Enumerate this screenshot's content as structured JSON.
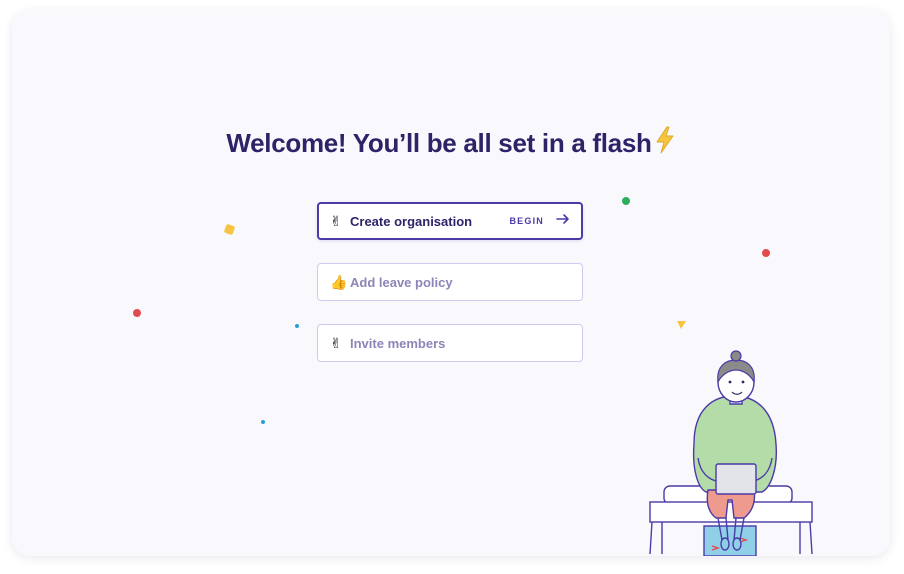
{
  "welcome": {
    "title": "Welcome! You’ll be all set in a flash",
    "title_icon": "lightning-bolt-icon"
  },
  "steps": [
    {
      "emoji": "✌",
      "label": "Create organisation",
      "action": "BEGIN",
      "icon": "arrow-right-icon",
      "state": "active"
    },
    {
      "emoji": "👍",
      "label": "Add leave policy",
      "state": "pending"
    },
    {
      "emoji": "✌",
      "label": "Invite members",
      "state": "pending"
    }
  ],
  "colors": {
    "brand": "#4b3aa7",
    "heading": "#2d2468",
    "muted_text": "#8c85b7",
    "card_bg": "#f9f8fd",
    "bolt": "#f5c542"
  },
  "illustration": "person-with-laptop-sitting-on-bench"
}
